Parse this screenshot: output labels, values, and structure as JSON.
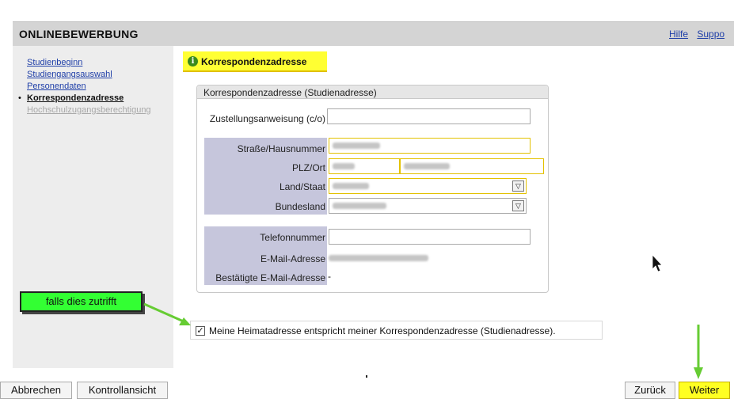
{
  "header": {
    "app_title": "ONLINEBEWERBUNG",
    "links": [
      "Hilfe",
      "Suppo"
    ]
  },
  "sidebar": {
    "items": [
      {
        "label": "Studienbeginn",
        "state": "link"
      },
      {
        "label": "Studiengangsauswahl",
        "state": "link"
      },
      {
        "label": "Personendaten",
        "state": "link"
      },
      {
        "label": "Korrespondenzadresse",
        "state": "active"
      },
      {
        "label": "Hochschulzugangsberechtigung",
        "state": "disabled"
      }
    ]
  },
  "section": {
    "tab_label": "Korrespondenzadresse",
    "info_icon": "i",
    "fieldset_title": "Korrespondenzadresse (Studienadresse)"
  },
  "form": {
    "c_o_label": "Zustellungsanweisung (c/o)",
    "street_label": "Straße/Hausnummer",
    "plz_label": "PLZ/Ort",
    "country_label": "Land/Staat",
    "state_label": "Bundesland",
    "phone_label": "Telefonnummer",
    "email_label": "E-Mail-Adresse",
    "confirmed_email_label": "Bestätigte E-Mail-Adresse",
    "confirmed_email_value": "-",
    "select_arrow": "▽"
  },
  "annotation": {
    "note": "falls dies zutrifft",
    "colors": {
      "highlight": "#ffff33",
      "note_bg": "#33ff33",
      "arrow": "#66cc33"
    }
  },
  "checkbox": {
    "checked_mark": "✓",
    "label": "Meine Heimatadresse entspricht meiner Korrespondenzadresse (Studienadresse)."
  },
  "footer": {
    "cancel": "Abbrechen",
    "control_view": "Kontrollansicht",
    "back": "Zurück",
    "next": "Weiter"
  }
}
